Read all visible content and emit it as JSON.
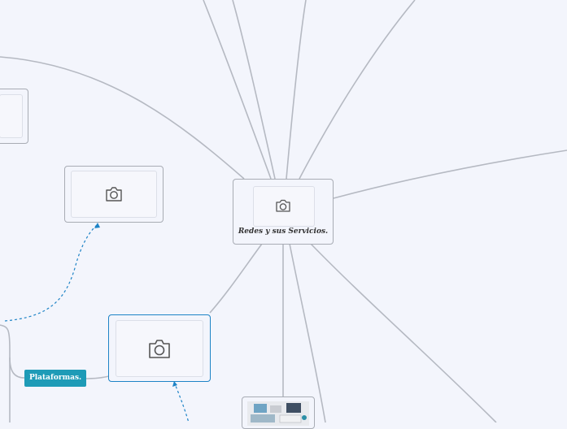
{
  "central_topic": {
    "label": "Redes y sus Servicios.",
    "icon": "camera-icon"
  },
  "nodes": {
    "image_left_partial": {
      "icon": "camera-icon"
    },
    "image_mid_left": {
      "icon": "camera-icon"
    },
    "image_selected": {
      "icon": "camera-icon"
    },
    "image_bottom_photo": {
      "icon": "office-photo"
    }
  },
  "tags": {
    "plataformas": "Plataformas."
  },
  "colors": {
    "background": "#f3f5fc",
    "link": "#b5b9c2",
    "selection": "#1d83c6",
    "tag": "#1e9bb7"
  }
}
